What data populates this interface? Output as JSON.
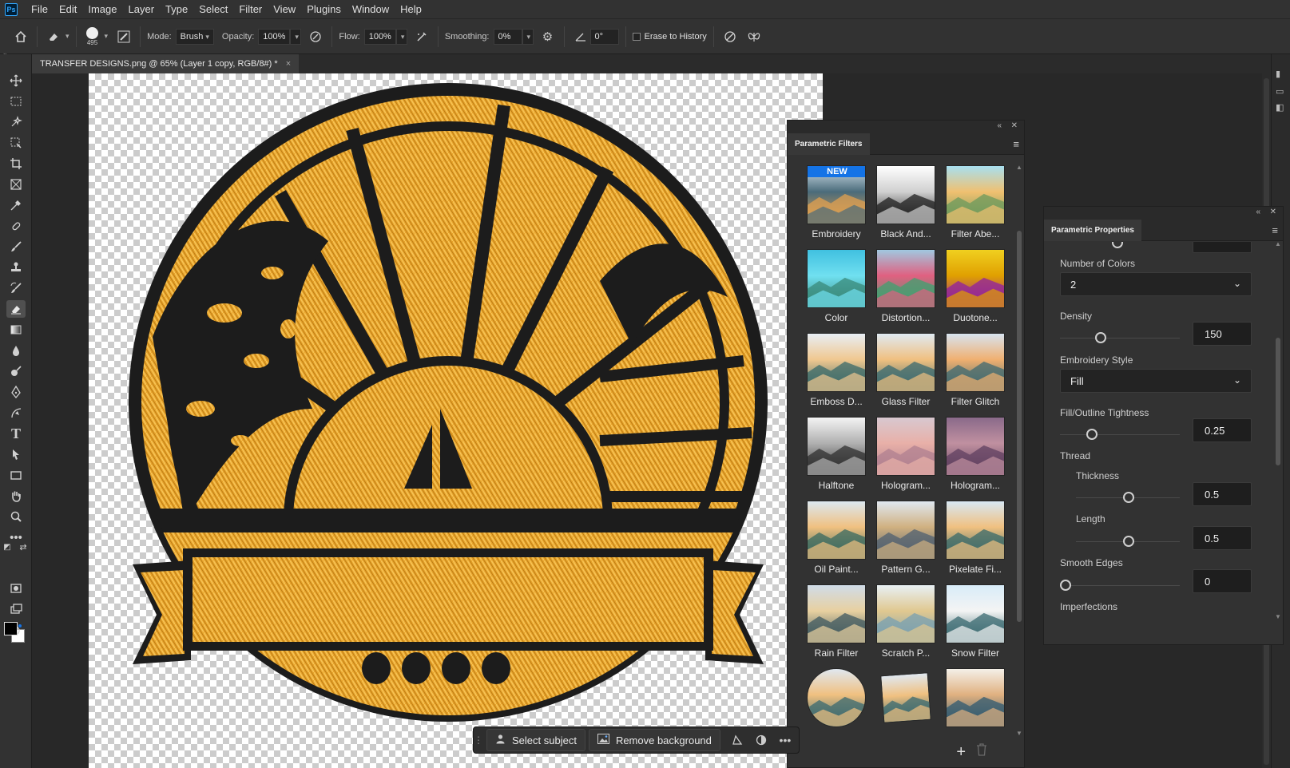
{
  "app": {
    "logo": "Ps"
  },
  "menu": [
    "File",
    "Edit",
    "Image",
    "Layer",
    "Type",
    "Select",
    "Filter",
    "View",
    "Plugins",
    "Window",
    "Help"
  ],
  "options": {
    "brush_size": "495",
    "mode_label": "Mode:",
    "mode_value": "Brush",
    "opacity_label": "Opacity:",
    "opacity_value": "100%",
    "flow_label": "Flow:",
    "flow_value": "100%",
    "smoothing_label": "Smoothing:",
    "smoothing_value": "0%",
    "angle_value": "0°",
    "erase_history_label": "Erase to History",
    "erase_history_checked": false
  },
  "document": {
    "tab_title": "TRANSFER DESIGNS.png @ 65% (Layer 1 copy, RGB/8#) *",
    "close": "×"
  },
  "parametric_filters": {
    "title": "Parametric Filters",
    "new_badge": "NEW",
    "items": [
      {
        "label": "Embroidery",
        "icon": "embroidery-thumb",
        "colors": [
          "#d6e4ee",
          "#4a6b7a",
          "#e0a050"
        ]
      },
      {
        "label": "Black And...",
        "icon": "black-and-white-thumb",
        "colors": [
          "#ffffff",
          "#d0d0d0",
          "#202020"
        ]
      },
      {
        "label": "Filter Abe...",
        "icon": "filter-aberration-thumb",
        "colors": [
          "#a8e0f0",
          "#f0c070",
          "#6c9a5c"
        ]
      },
      {
        "label": "Color",
        "icon": "color-thumb",
        "colors": [
          "#40c0e0",
          "#70e0f0",
          "#3a8a7a"
        ]
      },
      {
        "label": "Distortion...",
        "icon": "distortion-thumb",
        "colors": [
          "#a0c8e0",
          "#e06080",
          "#40a070"
        ]
      },
      {
        "label": "Duotone...",
        "icon": "duotone-thumb",
        "colors": [
          "#f0d020",
          "#e0a000",
          "#9020a0"
        ]
      },
      {
        "label": "Emboss D...",
        "icon": "emboss-thumb",
        "colors": [
          "#e8eef4",
          "#f0c890",
          "#3a6a6a"
        ]
      },
      {
        "label": "Glass Filter",
        "icon": "glass-filter-thumb",
        "colors": [
          "#e0eaf2",
          "#f0c080",
          "#3a6a70"
        ]
      },
      {
        "label": "Filter Glitch",
        "icon": "filter-glitch-thumb",
        "colors": [
          "#d8e4f0",
          "#f0b070",
          "#406a70"
        ]
      },
      {
        "label": "Halftone",
        "icon": "halftone-thumb",
        "colors": [
          "#f4f4f4",
          "#b0b0b0",
          "#303030"
        ]
      },
      {
        "label": "Hologram...",
        "icon": "hologram-thumb-1",
        "colors": [
          "#d8c8d0",
          "#e8b0a8",
          "#b08090"
        ]
      },
      {
        "label": "Hologram...",
        "icon": "hologram-thumb-2",
        "colors": [
          "#8a6a8a",
          "#c090a0",
          "#604060"
        ]
      },
      {
        "label": "Oil Paint...",
        "icon": "oil-paint-thumb",
        "colors": [
          "#dce8f0",
          "#f0c080",
          "#3a6a60"
        ]
      },
      {
        "label": "Pattern G...",
        "icon": "pattern-thumb",
        "colors": [
          "#e0e8f0",
          "#d0b080",
          "#506070"
        ]
      },
      {
        "label": "Pixelate Fi...",
        "icon": "pixelate-thumb",
        "colors": [
          "#d8e8f4",
          "#f0c080",
          "#3a6a6a"
        ]
      },
      {
        "label": "Rain Filter",
        "icon": "rain-filter-thumb",
        "colors": [
          "#d0dce8",
          "#e8d0a0",
          "#405a60"
        ]
      },
      {
        "label": "Scratch P...",
        "icon": "scratch-thumb",
        "colors": [
          "#e8f0f4",
          "#e0c890",
          "#7aa0b0"
        ]
      },
      {
        "label": "Snow Filter",
        "icon": "snow-filter-thumb",
        "colors": [
          "#d8ecf8",
          "#f4f4f4",
          "#3a6a70"
        ]
      },
      {
        "label": "",
        "icon": "sphere-thumb",
        "colors": [
          "#e0e8f0",
          "#f0c080",
          "#3a6a70"
        ]
      },
      {
        "label": "",
        "icon": "tilt-thumb",
        "colors": [
          "#e0e8f0",
          "#f0c080",
          "#3a6a70"
        ]
      },
      {
        "label": "",
        "icon": "kaleidoscope-thumb",
        "colors": [
          "#f4f0e8",
          "#e0b080",
          "#305a70"
        ]
      }
    ]
  },
  "parametric_properties": {
    "title": "Parametric Properties",
    "number_of_colors_label": "Number of Colors",
    "number_of_colors_value": "2",
    "density_label": "Density",
    "density_value": "150",
    "embroidery_style_label": "Embroidery Style",
    "embroidery_style_value": "Fill",
    "tightness_label": "Fill/Outline Tightness",
    "tightness_value": "0.25",
    "thread_label": "Thread",
    "thickness_label": "Thickness",
    "thickness_value": "0.5",
    "length_label": "Length",
    "length_value": "0.5",
    "smooth_edges_label": "Smooth Edges",
    "smooth_edges_value": "0",
    "imperfections_label": "Imperfections"
  },
  "contextual_bar": {
    "select_subject": "Select subject",
    "remove_background": "Remove background"
  },
  "colors": {
    "foreground": "#000000",
    "background": "#ffffff",
    "embroidery_gold": "#e8a32a",
    "embroidery_dark": "#1c1c1c",
    "accent": "#1473e6"
  }
}
